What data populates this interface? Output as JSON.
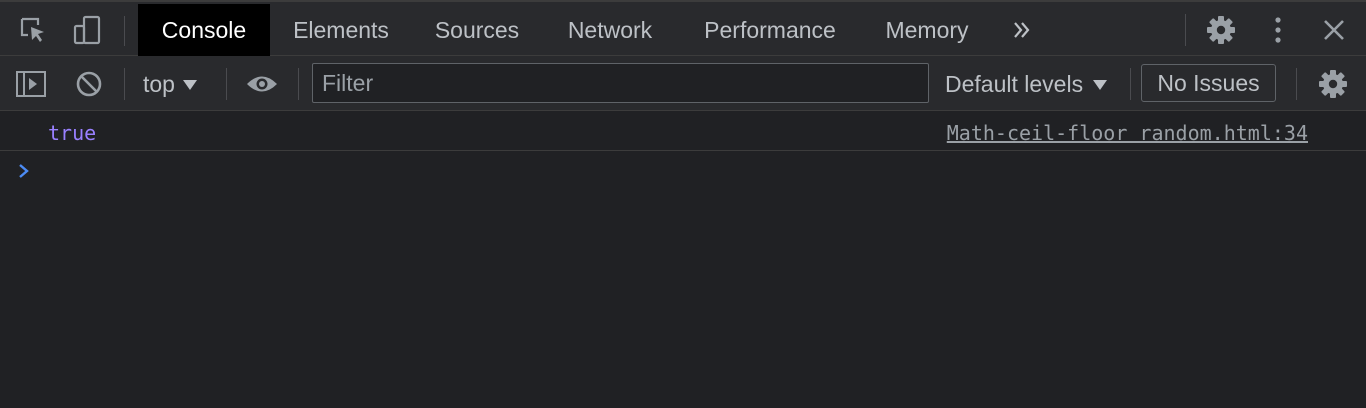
{
  "tabs": [
    {
      "label": "Console",
      "active": true
    },
    {
      "label": "Elements",
      "active": false
    },
    {
      "label": "Sources",
      "active": false
    },
    {
      "label": "Network",
      "active": false
    },
    {
      "label": "Performance",
      "active": false
    },
    {
      "label": "Memory",
      "active": false
    }
  ],
  "toolbar": {
    "context": "top",
    "filter_placeholder": "Filter",
    "levels_label": "Default levels",
    "issues_label": "No Issues"
  },
  "console": {
    "messages": [
      {
        "value": "true",
        "source": "Math-ceil-floor random.html:34"
      }
    ]
  },
  "icons": {
    "inspect": "inspect-element-icon",
    "device": "device-toggle-icon",
    "more_tabs": "chevron-double-right-icon",
    "settings": "gear-icon",
    "menu": "vertical-dots-icon",
    "close": "close-icon",
    "sidebar": "sidebar-toggle-icon",
    "clear": "clear-console-icon",
    "eye": "eye-icon",
    "console_settings": "gear-icon",
    "prompt": "chevron-right-icon"
  },
  "colors": {
    "background": "#202124",
    "toolbar": "#292a2d",
    "active_tab": "#000000",
    "boolean_value": "#9980ff",
    "prompt": "#4c8cf5"
  }
}
